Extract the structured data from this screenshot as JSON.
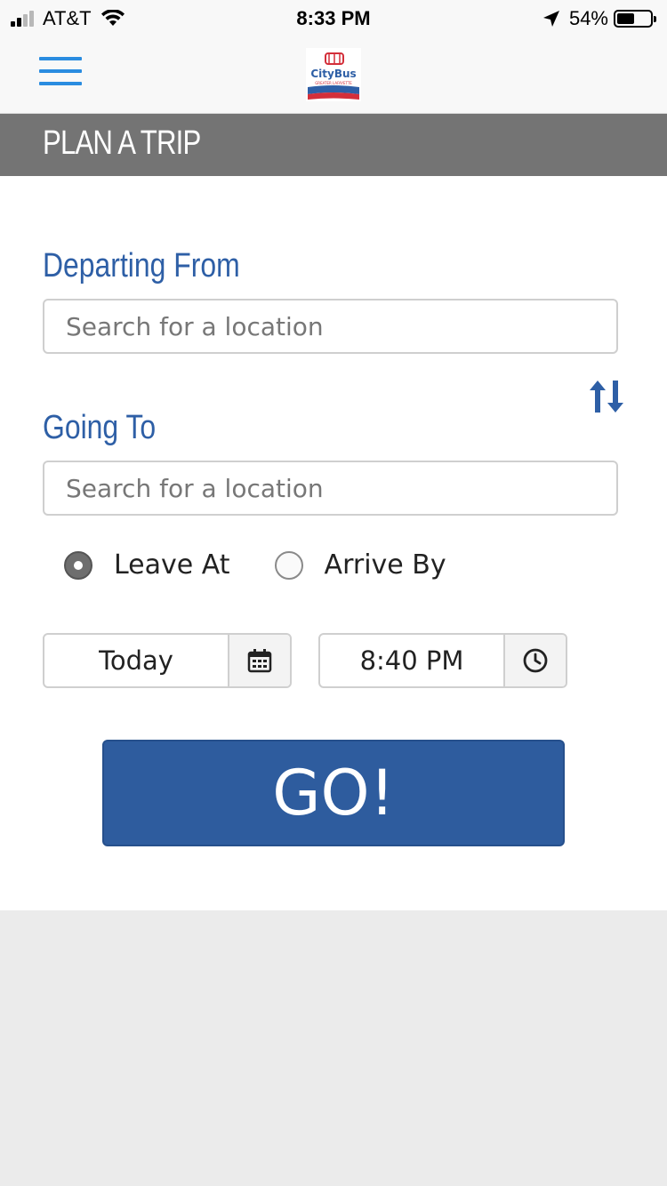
{
  "status_bar": {
    "carrier": "AT&T",
    "time": "8:33 PM",
    "battery": "54%",
    "battery_level": 0.54
  },
  "header": {
    "menu_icon": "hamburger-icon",
    "logo_text": "CityBus",
    "logo_subtext": "GREATER LAFAYETTE"
  },
  "page": {
    "title": "PLAN A TRIP"
  },
  "form": {
    "departing_label": "Departing From",
    "departing_placeholder": "Search for a location",
    "going_label": "Going To",
    "going_placeholder": "Search for a location",
    "swap_icon": "swap-vertical-icon",
    "options": [
      {
        "label": "Leave At",
        "selected": true
      },
      {
        "label": "Arrive By",
        "selected": false
      }
    ],
    "date_value": "Today",
    "date_icon": "calendar-icon",
    "time_value": "8:40 PM",
    "time_icon": "clock-icon",
    "go_label": "GO!"
  },
  "colors": {
    "accent_blue": "#2e5fa6",
    "button_blue": "#2e5c9e",
    "title_band": "#747474",
    "menu_blue": "#2a8ce0"
  }
}
